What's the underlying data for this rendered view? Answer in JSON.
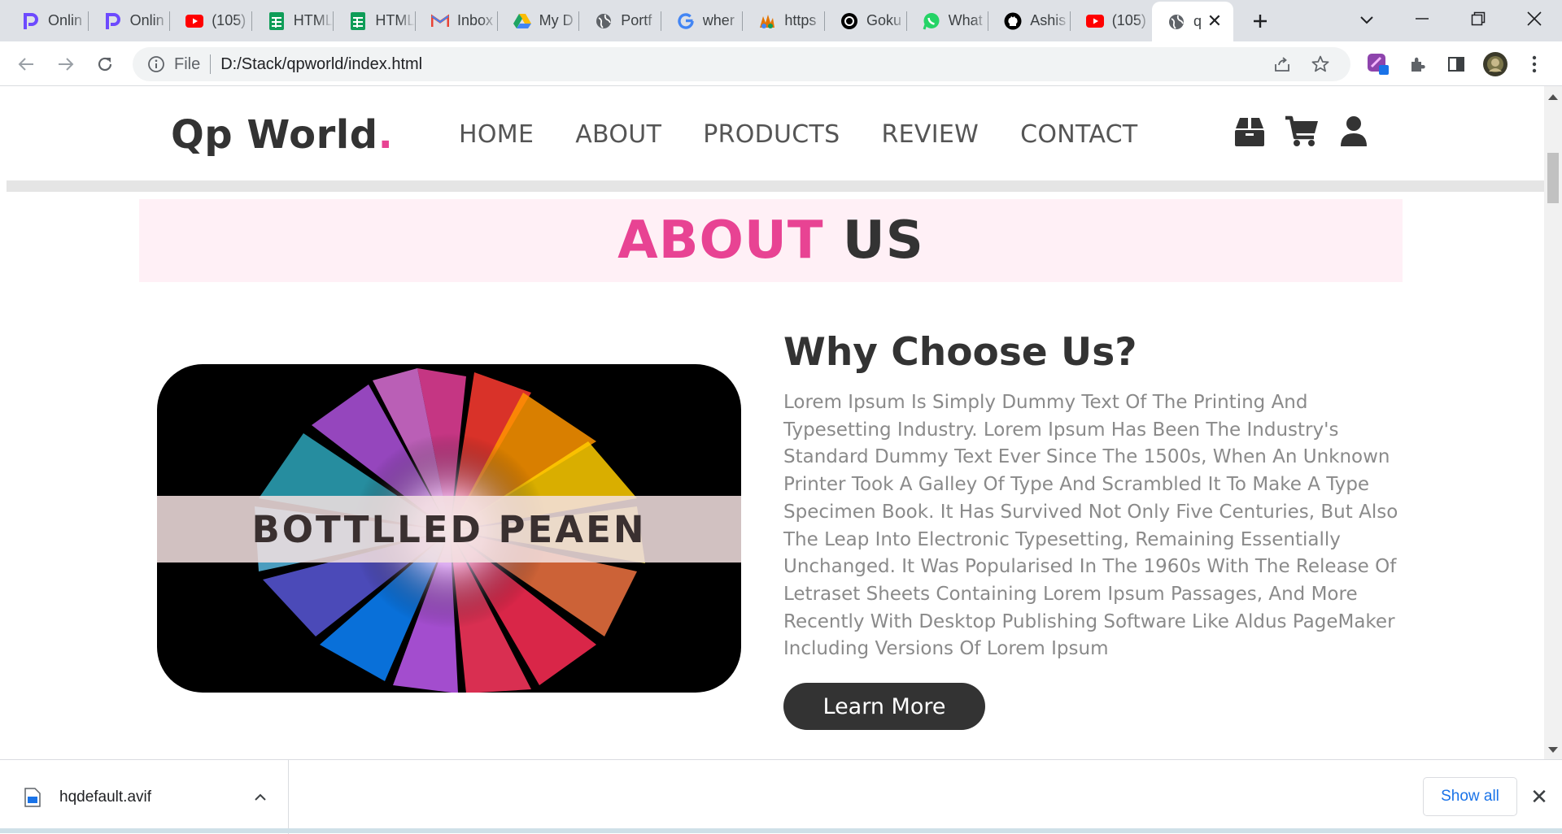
{
  "browser": {
    "tabs": [
      {
        "icon": "proton-icon",
        "title": "Onlin",
        "color": "#6d4aff"
      },
      {
        "icon": "proton-icon",
        "title": "Onlin",
        "color": "#6d4aff"
      },
      {
        "icon": "youtube-icon",
        "title": "(105)",
        "color": "#ff0000"
      },
      {
        "icon": "sheets-icon",
        "title": "HTML",
        "color": "#0f9d58"
      },
      {
        "icon": "sheets-icon",
        "title": "HTML",
        "color": "#0f9d58"
      },
      {
        "icon": "gmail-icon",
        "title": "Inbox",
        "color": "#ea4335"
      },
      {
        "icon": "drive-icon",
        "title": "My D",
        "color": "#1fa463"
      },
      {
        "icon": "globe-icon",
        "title": "Portf",
        "color": "#5f6368"
      },
      {
        "icon": "google-icon",
        "title": "wher",
        "color": "#4285f4"
      },
      {
        "icon": "hands-icon",
        "title": "https",
        "color": "#e37400"
      },
      {
        "icon": "openai-icon",
        "title": "Goku",
        "color": "#000000"
      },
      {
        "icon": "whatsapp-icon",
        "title": "What",
        "color": "#25d366"
      },
      {
        "icon": "github-icon",
        "title": "Ashis",
        "color": "#000000"
      },
      {
        "icon": "youtube-icon",
        "title": "(105)",
        "color": "#ff0000"
      }
    ],
    "active_tab": {
      "icon": "globe-icon",
      "title": "q"
    },
    "address": {
      "scheme": "File",
      "url": "D:/Stack/qpworld/index.html"
    }
  },
  "site": {
    "logo": {
      "text": "Qp World",
      "dot": "."
    },
    "nav": [
      "HOME",
      "ABOUT",
      "PRODUCTS",
      "REVIEW",
      "CONTACT"
    ],
    "header_icons": [
      "box-icon",
      "cart-icon",
      "user-icon"
    ],
    "accent_color": "#e84393",
    "dark_color": "#333333"
  },
  "about": {
    "heading_accent": "ABOUT",
    "heading_rest": "US",
    "image_banner": "BOTTLLED PEAEN",
    "title": "Why Choose Us?",
    "paragraph": "Lorem Ipsum Is Simply Dummy Text Of The Printing And Typesetting Industry. Lorem Ipsum Has Been The Industry's Standard Dummy Text Ever Since The 1500s, When An Unknown Printer Took A Galley Of Type And Scrambled It To Make A Type Specimen Book. It Has Survived Not Only Five Centuries, But Also The Leap Into Electronic Typesetting, Remaining Essentially Unchanged. It Was Popularised In The 1960s With The Release Of Letraset Sheets Containing Lorem Ipsum Passages, And More Recently With Desktop Publishing Software Like Aldus PageMaker Including Versions Of Lorem Ipsum",
    "button": "Learn More"
  },
  "downloads": {
    "file_name": "hqdefault.avif",
    "show_all": "Show all"
  }
}
